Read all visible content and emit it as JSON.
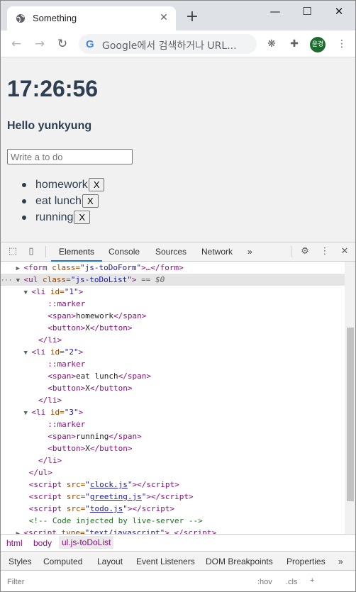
{
  "browser": {
    "tab_title": "Something",
    "tab_close": "✕",
    "new_tab": "+",
    "window_minimize": "—",
    "window_maximize": "☐",
    "window_close": "✕",
    "address_placeholder": "Google에서 검색하거나 URL...",
    "google_g": "G",
    "profile_avatar_text": "윤경"
  },
  "page": {
    "clock": "17:26:56",
    "greeting": "Hello yunkyung",
    "todo_placeholder": "Write a to do",
    "todos": [
      {
        "text": "homework",
        "button": "X"
      },
      {
        "text": "eat lunch",
        "button": "X"
      },
      {
        "text": "running",
        "button": "X"
      }
    ]
  },
  "devtools": {
    "tabs": [
      "Elements",
      "Console",
      "Sources",
      "Network"
    ],
    "more_tabs": "»",
    "active_tab": "Elements",
    "dom": {
      "form_open": "<form ",
      "form_attr": "class=",
      "form_val": "\"js-toDoForm\"",
      "form_rest": ">…</form>",
      "ul_open": "<ul ",
      "ul_attr": "class=",
      "ul_val": "\"js-toDoList\"",
      "ul_close": ">",
      "selected_marker": "== $0",
      "li1_id": "\"1\"",
      "li2_id": "\"2\"",
      "li3_id": "\"3\"",
      "marker": "::marker",
      "span1": "homework",
      "span2": "eat lunch",
      "span3": "running",
      "button_text": "X",
      "li_close": "</li>",
      "ul_end": "</ul>",
      "script1_src": "clock.js",
      "script2_src": "greeting.js",
      "script3_src": "todo.js",
      "comment": "<!-- Code injected by live-server -->",
      "script4_type": "\"text/javascript\""
    },
    "breadcrumbs": [
      "html",
      "body",
      "ul.js-toDoList"
    ],
    "lower_tabs": [
      "Styles",
      "Computed",
      "Layout",
      "Event Listeners",
      "DOM Breakpoints",
      "Properties"
    ],
    "lower_more": "»",
    "filter_placeholder": "Filter",
    "filter_hov": ":hov",
    "filter_cls": ".cls",
    "filter_plus": "+"
  }
}
